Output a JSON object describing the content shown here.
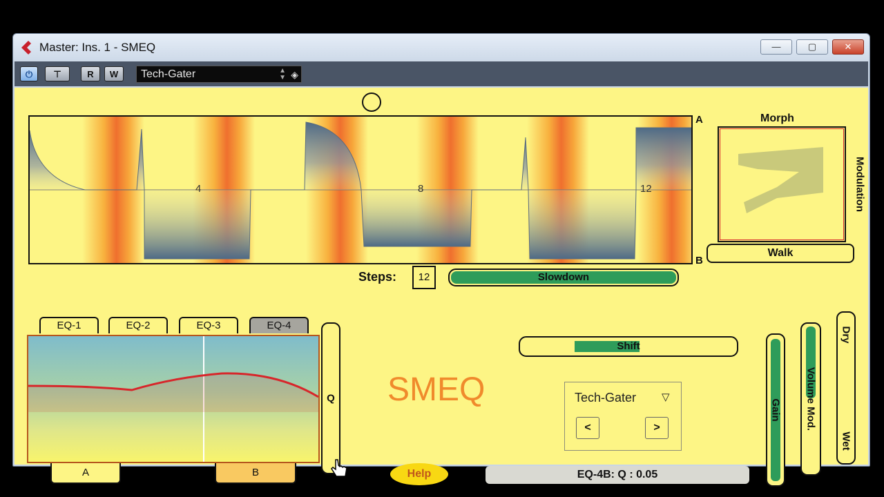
{
  "window": {
    "title": "Master: Ins. 1 - SMEQ",
    "minimize_glyph": "—",
    "maximize_glyph": "▢",
    "close_glyph": "✕"
  },
  "toolbar": {
    "power_glyph": "⏻",
    "bypass_glyph": "⊤",
    "read_label": "R",
    "write_label": "W",
    "preset_name": "Tech-Gater"
  },
  "step_display": {
    "corner_a": "A",
    "corner_b": "B",
    "marker_4": "4",
    "marker_8": "8",
    "marker_12": "12"
  },
  "morph": {
    "title": "Morph",
    "side_label": "Modulation",
    "walk_label": "Walk"
  },
  "steps": {
    "label": "Steps:",
    "value": "12"
  },
  "sliders": {
    "slowdown": {
      "label": "Slowdown",
      "value": 1.0
    },
    "shift": {
      "label": "Shift",
      "start": 0.25,
      "end": 0.55
    },
    "q_label": "Q",
    "gain_label": "Gain",
    "volume_mod_label": "Volume Mod.",
    "dry_label": "Dry",
    "wet_label": "Wet"
  },
  "eq": {
    "tabs": [
      "EQ-1",
      "EQ-2",
      "EQ-3",
      "EQ-4"
    ],
    "active_tab": 3,
    "a_label": "A",
    "b_label": "B"
  },
  "brand": "SMEQ",
  "preset_selector": {
    "name": "Tech-Gater",
    "prev_label": "<",
    "next_label": ">"
  },
  "help_label": "Help",
  "status_text": "EQ-4B: Q : 0.05",
  "colors": {
    "panel": "#fdf585",
    "accent_green": "#2e9c5a",
    "curve_red": "#d8262b",
    "brand_orange": "#f08a2c"
  }
}
